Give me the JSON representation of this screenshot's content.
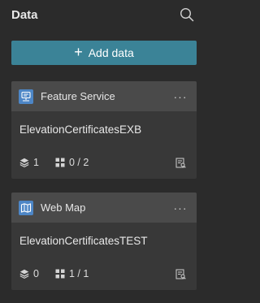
{
  "panel": {
    "title": "Data",
    "search_icon": "search-icon"
  },
  "add_button": {
    "label": "Add data",
    "icon": "plus-icon",
    "color": "#3b8397"
  },
  "cards": [
    {
      "type_label": "Feature Service",
      "type_icon": "feature-service-icon",
      "name": "ElevationCertificatesEXB",
      "layers_count": "1",
      "widgets_count": "0 / 2",
      "more_label": "···"
    },
    {
      "type_label": "Web Map",
      "type_icon": "web-map-icon",
      "name": "ElevationCertificatesTEST",
      "layers_count": "0",
      "widgets_count": "1 / 1",
      "more_label": "···"
    }
  ],
  "colors": {
    "background": "#2b2b2b",
    "card": "#383838",
    "card_header": "#4a4a4a",
    "type_icon_bg": "#4d86c6"
  }
}
